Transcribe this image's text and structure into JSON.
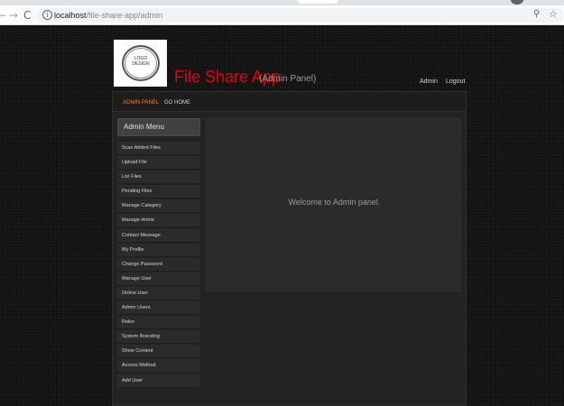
{
  "browser": {
    "url_host": "localhost",
    "url_path": "/file-share-app/admin",
    "icons": [
      "back-icon",
      "forward-icon",
      "reload-icon",
      "info-icon",
      "zoom-icon",
      "bookmark-star-icon"
    ]
  },
  "header": {
    "logo_text_line1": "LOGO",
    "logo_text_line2": "DESIGN",
    "app_title": "File Share App",
    "app_subtitle": "(Admin Panel)",
    "admin_link": "Admin",
    "logout_link": "Logout"
  },
  "navbar": {
    "items": [
      {
        "label": "ADMIN PANEL",
        "active": true
      },
      {
        "label": "GO HOME",
        "active": false
      }
    ]
  },
  "sidebar": {
    "header": "Admin Menu",
    "items": [
      {
        "label": "Scan Added Files"
      },
      {
        "label": "Upload File"
      },
      {
        "label": "List Files"
      },
      {
        "label": "Pending Files"
      },
      {
        "label": "Manage Category"
      },
      {
        "label": "Manage Home"
      },
      {
        "label": "Contact Message"
      },
      {
        "label": "My Profile"
      },
      {
        "label": "Change Password"
      },
      {
        "label": "Manage User"
      },
      {
        "label": "Online User"
      },
      {
        "label": "Admin Users"
      },
      {
        "label": "Roles"
      },
      {
        "label": "System Branding"
      },
      {
        "label": "Show Content"
      },
      {
        "label": "Access Method"
      },
      {
        "label": "Add User"
      }
    ]
  },
  "content": {
    "welcome": "Welcome to Admin panel."
  },
  "colors": {
    "title": "#e8000b",
    "active_nav": "#ff7a1a",
    "panel": "#232323",
    "menu_item": "#2b2b2b"
  }
}
